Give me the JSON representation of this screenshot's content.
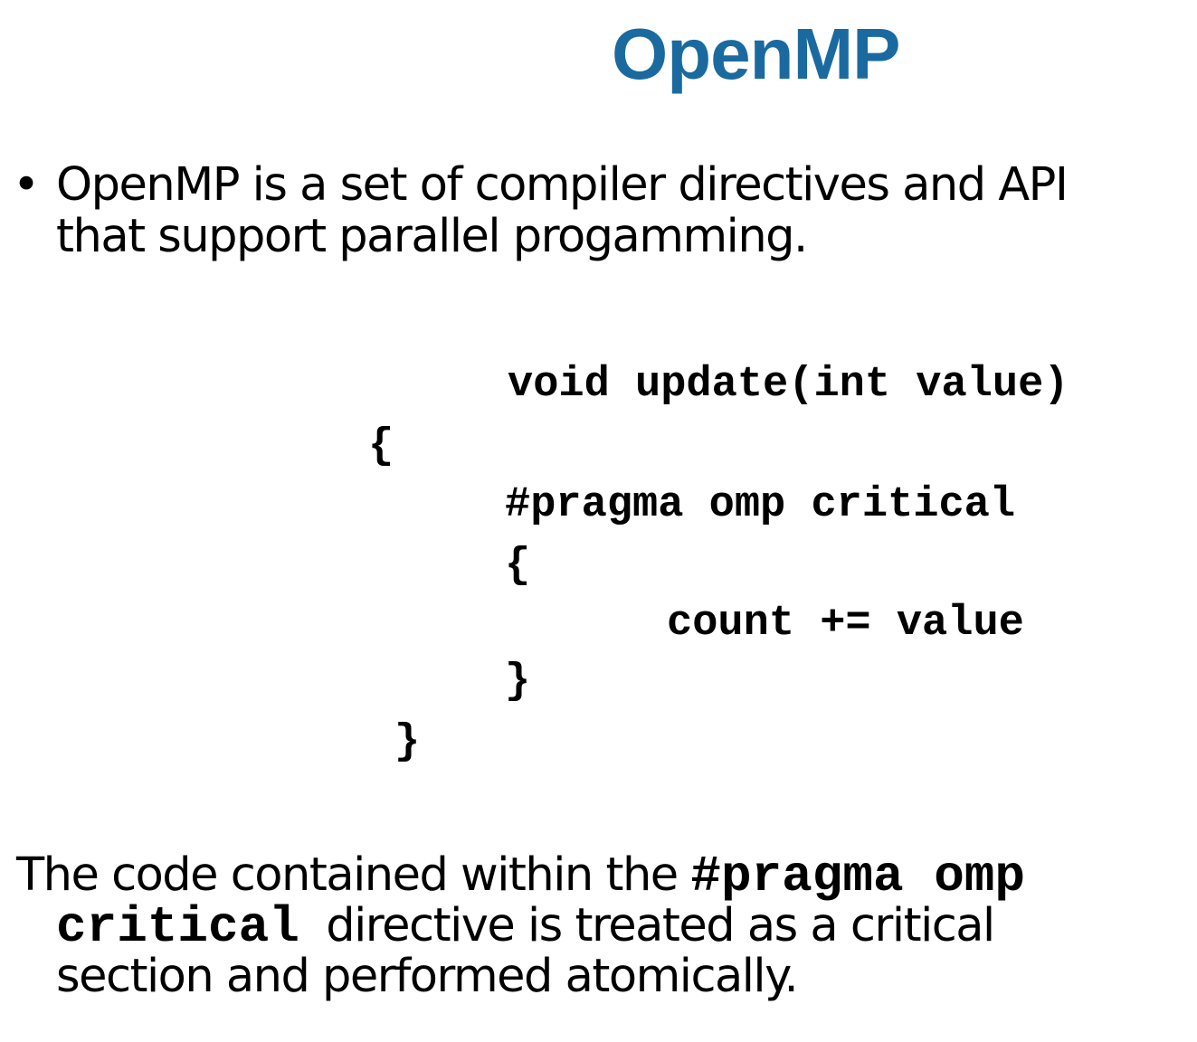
{
  "slide": {
    "title": "OpenMP",
    "title_color": "#1a6aa0",
    "bullet": {
      "marker": "•",
      "line1": "OpenMP is a set of compiler directives and API",
      "line2": "that support parallel progamming."
    },
    "code": {
      "line1": "void update(int value)",
      "line2": "{",
      "line3": "#pragma omp critical",
      "line4": "{",
      "line5": "count += value",
      "line6": "}",
      "line7": "}"
    },
    "paragraph": {
      "part1": "The code contained within the ",
      "code1": "#pragma omp",
      "code2": "critical",
      "part2": "  directive is treated as a critical",
      "part3": "section and performed atomically."
    }
  }
}
